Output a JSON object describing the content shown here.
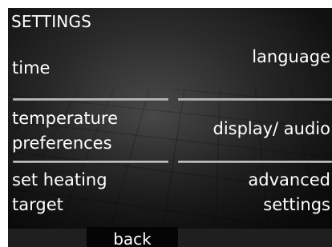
{
  "header": {
    "title": "SETTINGS"
  },
  "menu": {
    "time": "time",
    "language": "language",
    "temperature_preferences": [
      "temperature",
      "preferences"
    ],
    "display_audio": "display/ audio",
    "set_heating_target": [
      "set heating",
      "target"
    ],
    "advanced_settings": [
      "advanced",
      "settings"
    ]
  },
  "footer": {
    "back_label": "back"
  }
}
